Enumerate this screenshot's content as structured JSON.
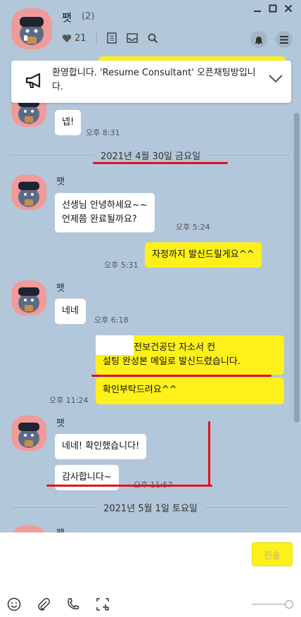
{
  "header": {
    "title": "팻",
    "member_count": "(2)",
    "like_count": "21"
  },
  "notice": {
    "text": "환영합니다. 'Resume Consultant' 오픈채팅방입니다."
  },
  "messages": {
    "m1": {
      "text": "넵!",
      "time": "오후 8:31"
    },
    "date1": "2021년 4월 30일 금요일",
    "m2": {
      "sender": "팻",
      "text": "선생님 안녕하세요~~\n언제쯤 완료될까요?",
      "time": "오후 5:24"
    },
    "m3": {
      "text": "자정까지 발신드릴게요^^",
      "time": "오후 5:31"
    },
    "m4": {
      "sender": "팻",
      "text": "네네",
      "time": "오후 6:18"
    },
    "m5": {
      "text": ", 산업안전보건공단 자소서 컨\n설팅 완성본 메일로 발신드렸습니다.",
      "text2": "확인부탁드려요^^",
      "time": "오후 11:24"
    },
    "m6": {
      "sender": "팻",
      "text": "네네! 확인했습니다!",
      "text2": "감사합니다~",
      "time": "오후 11:57"
    },
    "date2": "2021년 5월 1일 토요일",
    "m7": {
      "sender": "팻"
    }
  },
  "input": {
    "send_label": "전송"
  },
  "colors": {
    "chat_bg": "#b2c7d9",
    "my_bubble": "#fef01b",
    "annotation_red": "#e0121c"
  }
}
